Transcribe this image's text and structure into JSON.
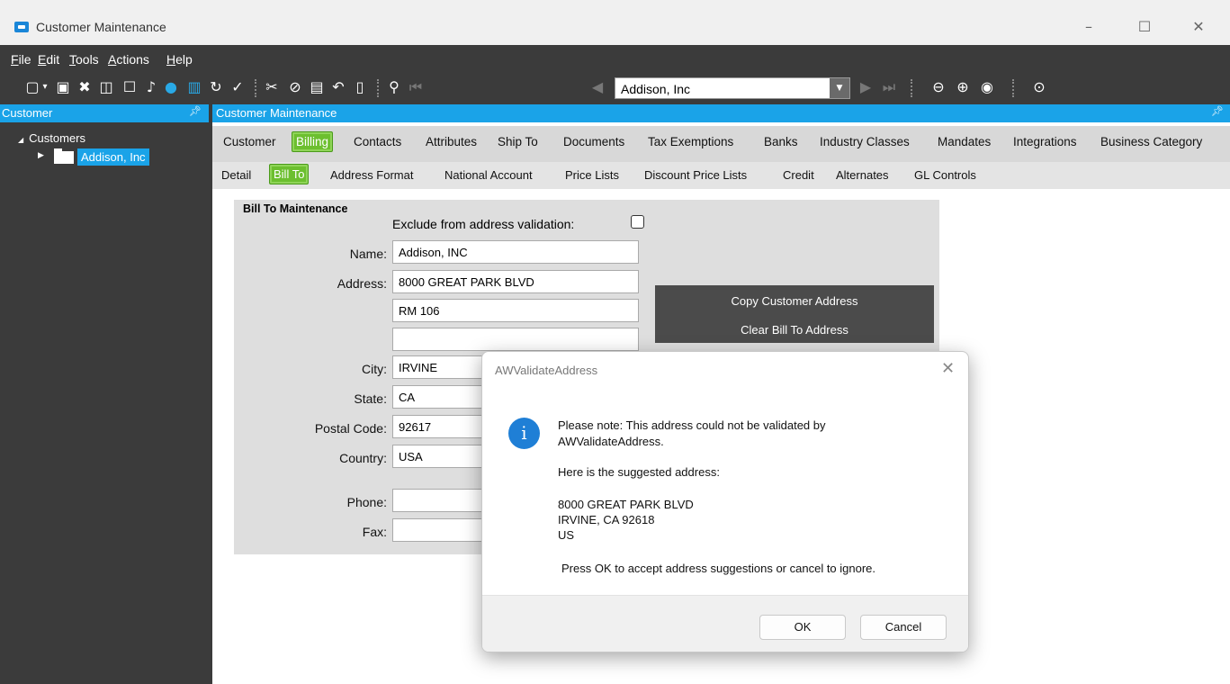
{
  "window": {
    "title": "Customer Maintenance"
  },
  "menu": [
    {
      "label": "File",
      "ul": "F",
      "rest": "ile"
    },
    {
      "label": "Edit",
      "ul": "E",
      "rest": "dit"
    },
    {
      "label": "Tools",
      "ul": "T",
      "rest": "ools"
    },
    {
      "label": "Actions",
      "ul": "A",
      "rest": "ctions"
    },
    {
      "label": "Help",
      "ul": "H",
      "rest": "elp"
    }
  ],
  "toolbar": {
    "record_selector": "Addison, Inc"
  },
  "left_panel": {
    "header": "Customer",
    "tree_root": "Customers",
    "tree_selected": "Addison, Inc"
  },
  "right_panel": {
    "header": "Customer Maintenance",
    "tabs": [
      "Customer",
      "Billing",
      "Contacts",
      "Attributes",
      "Ship To",
      "Documents",
      "Tax Exemptions",
      "Banks",
      "Industry Classes",
      "Mandates",
      "Integrations",
      "Business Category"
    ],
    "active_tab": "Billing",
    "subtabs": [
      "Detail",
      "Bill To",
      "Address Format",
      "National Account",
      "Price Lists",
      "Discount Price Lists",
      "Credit",
      "Alternates",
      "GL Controls"
    ],
    "active_subtab": "Bill To"
  },
  "form": {
    "group_title": "Bill To Maintenance",
    "exclude_label": "Exclude from address validation:",
    "exclude_checked": false,
    "name_label": "Name:",
    "name_value": "Addison, INC",
    "address_label": "Address:",
    "address1": "8000 GREAT PARK BLVD",
    "address2": "RM 106",
    "address3": "",
    "city_label": "City:",
    "city_value": "IRVINE",
    "state_label": "State:",
    "state_value": "CA",
    "postal_label": "Postal Code:",
    "postal_value": "92617",
    "country_label": "Country:",
    "country_value": "USA",
    "phone_label": "Phone:",
    "phone_value": "",
    "fax_label": "Fax:",
    "fax_value": "",
    "copy_button": "Copy Customer Address",
    "clear_button": "Clear Bill To Address"
  },
  "dialog": {
    "title": "AWValidateAddress",
    "line1": "Please note: This address could not be validated by",
    "line2": "AWValidateAddress.",
    "suggest_heading": "Here is the suggested address:",
    "addr1": "8000 GREAT PARK BLVD",
    "addr2": "IRVINE, CA 92618",
    "addr3": "US",
    "instruction": "Press OK to accept address suggestions or cancel to ignore.",
    "ok": "OK",
    "cancel": "Cancel"
  }
}
